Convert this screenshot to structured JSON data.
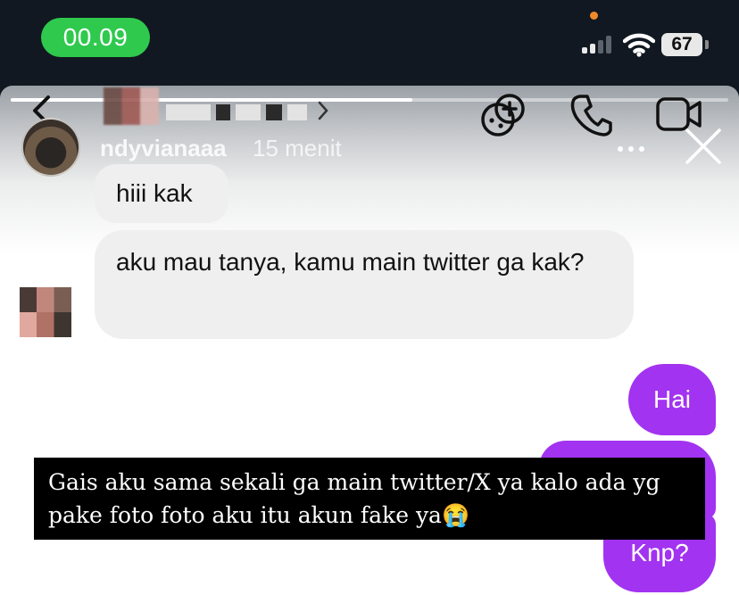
{
  "status_bar": {
    "time": "00.09",
    "battery": "67"
  },
  "chat_header": {
    "back_icon": "chevron-left-icon",
    "actions": [
      "game-icon",
      "phone-icon",
      "video-icon"
    ],
    "chevron": ">"
  },
  "story": {
    "username": "ndyvianaaa",
    "time_ago": "15 menit",
    "more_icon": "more-icon",
    "close_icon": "close-icon",
    "progress": 0.56
  },
  "messages": [
    {
      "side": "incoming",
      "text": "hiii kak"
    },
    {
      "side": "incoming",
      "text": "aku mau tanya, kamu main twitter ga kak?"
    },
    {
      "side": "outgoing",
      "text": "Hai"
    },
    {
      "side": "outgoing",
      "text": ""
    },
    {
      "side": "outgoing",
      "text": "Knp?"
    }
  ],
  "caption": {
    "line1": "Gais aku sama sekali ga main twitter/X ya kalo ada yg",
    "line2": "pake foto foto aku itu akun fake ya😭"
  },
  "colors": {
    "time_pill": "#2fc94e",
    "outgoing_bubble": "#a233f0",
    "incoming_bubble": "#efefef",
    "caption_bg": "#000000"
  }
}
